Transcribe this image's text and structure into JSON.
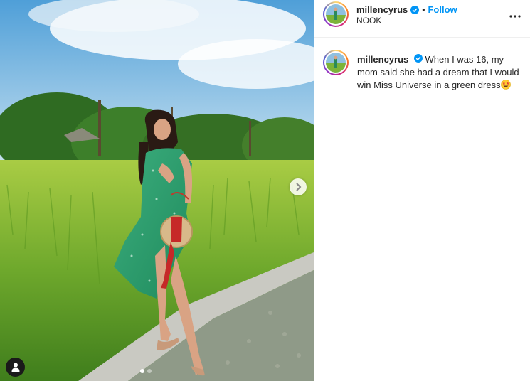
{
  "post": {
    "username": "millencyrus",
    "verified": true,
    "follow_label": "Follow",
    "separator": "•",
    "location": "NOOK",
    "caption": "When I was 16, my mom said she had a dream that I would win Miss Universe in a green dress",
    "caption_emoji": "star-struck"
  },
  "carousel": {
    "slide_count": 2,
    "current_slide": 1
  },
  "icons": {
    "verified": "verified-badge-icon",
    "more": "more-options-icon",
    "next": "chevron-right-icon",
    "tag": "user-tag-icon"
  },
  "colors": {
    "link_blue": "#0095f6",
    "text": "#262626",
    "divider": "#efefef"
  }
}
